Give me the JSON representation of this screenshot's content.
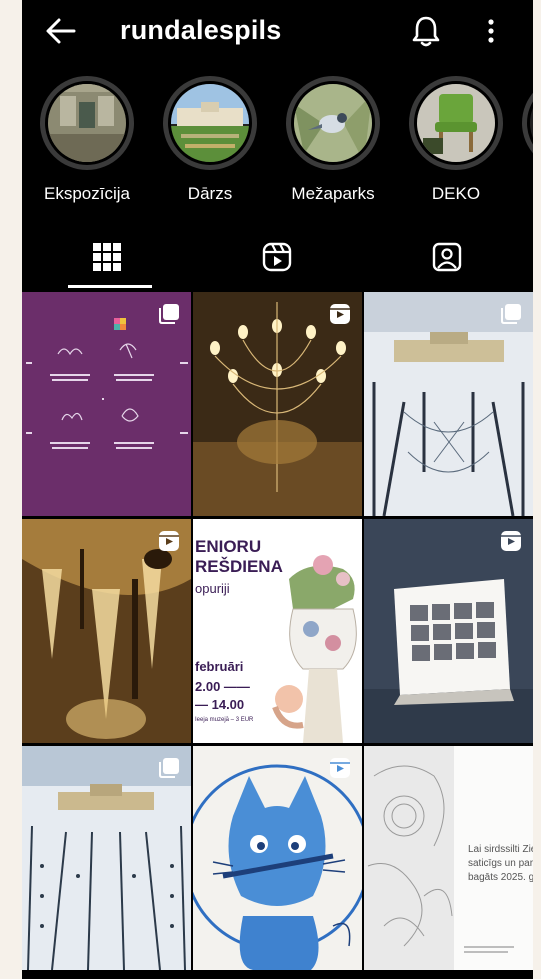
{
  "header": {
    "username": "rundalespils"
  },
  "stories": [
    {
      "label": "Ekspozīcija"
    },
    {
      "label": "Dārzs"
    },
    {
      "label": "Mežaparks"
    },
    {
      "label": "DEKO"
    }
  ],
  "tabs": [
    {
      "name": "grid",
      "active": true
    },
    {
      "name": "reels",
      "active": false
    },
    {
      "name": "tagged",
      "active": false
    }
  ],
  "posts": [
    {
      "subject": "purple-infographic",
      "badge": "carousel"
    },
    {
      "subject": "chandelier",
      "badge": "reel"
    },
    {
      "subject": "winter-palace-aerial",
      "badge": "carousel"
    },
    {
      "subject": "chandelier-closeup",
      "badge": "reel"
    },
    {
      "subject": "seniors-wednesday-poster",
      "badge": "none",
      "text": {
        "line1": "ENIORU",
        "line2": "REŠDIENA",
        "line3": "opuriji",
        "line4": "februāri",
        "line5": "2.00 ——",
        "line6": "— 14.00",
        "line7": "Ieeja muzejā – 3 EUR"
      }
    },
    {
      "subject": "lace-calendar",
      "badge": "reel"
    },
    {
      "subject": "snowy-palace-aerial",
      "badge": "carousel"
    },
    {
      "subject": "blue-cat-plate",
      "badge": "reel"
    },
    {
      "subject": "lace-greeting-card",
      "badge": "none",
      "text": {
        "line1": "Lai sirdssilti Zie",
        "line2": "saticīgs un par",
        "line3": "bagāts 2025. g"
      }
    }
  ],
  "colors": {
    "background": "#000000",
    "text": "#ffffff",
    "page_margin": "#f6f1ea"
  }
}
